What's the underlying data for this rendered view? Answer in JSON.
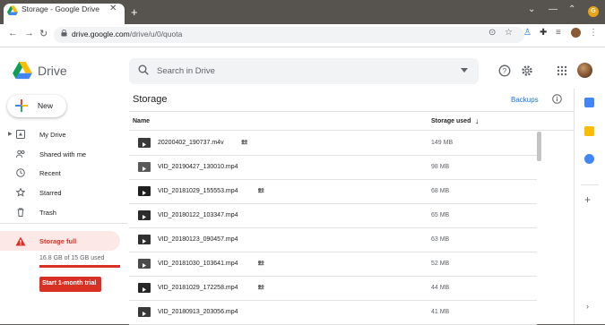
{
  "browser": {
    "tab_title": "Storage - Google Drive",
    "tab_close": "✕",
    "new_tab": "+",
    "window_controls": [
      "⌄",
      "—",
      "⌃",
      "✕"
    ],
    "profile_initial": "G",
    "url_host": "drive.google.com",
    "url_path": "/drive/u/0/quota",
    "nav_icons": [
      "back-icon",
      "forward-icon",
      "reload-icon"
    ],
    "toolbar_icons": [
      "lens-icon",
      "bookmark-star-icon",
      "extension-icon",
      "puzzle-icon",
      "media-icon",
      "profile-icon",
      "menu-icon"
    ]
  },
  "drive": {
    "logo_text": "Drive",
    "search_placeholder": "Search in Drive",
    "new_label": "New",
    "nav": [
      {
        "label": "My Drive",
        "icon": "my-drive-icon"
      },
      {
        "label": "Shared with me",
        "icon": "shared-icon"
      },
      {
        "label": "Recent",
        "icon": "clock-icon"
      },
      {
        "label": "Starred",
        "icon": "star-icon"
      },
      {
        "label": "Trash",
        "icon": "trash-icon"
      }
    ],
    "storage_full_label": "Storage full",
    "usage_text": "16.8 GB of 15 GB used",
    "trial_button": "Start 1-month trial",
    "page_title": "Storage",
    "backups_label": "Backups",
    "col_name": "Name",
    "col_storage": "Storage used",
    "files": [
      {
        "name": "20200402_190737.m4v",
        "size": "149 MB",
        "shared": true
      },
      {
        "name": "VID_20190427_130010.mp4",
        "size": "98 MB",
        "shared": false
      },
      {
        "name": "VID_20181029_155553.mp4",
        "size": "68 MB",
        "shared": true
      },
      {
        "name": "VID_20180122_103347.mp4",
        "size": "65 MB",
        "shared": false
      },
      {
        "name": "VID_20180123_090457.mp4",
        "size": "63 MB",
        "shared": false
      },
      {
        "name": "VID_20181030_103641.mp4",
        "size": "52 MB",
        "shared": true
      },
      {
        "name": "VID_20181029_172258.mp4",
        "size": "44 MB",
        "shared": true
      },
      {
        "name": "VID_20180913_203056.mp4",
        "size": "41 MB",
        "shared": false
      }
    ],
    "colors": {
      "accent": "#1a73e8",
      "danger": "#d93025",
      "warn_bg": "#fce8e6"
    }
  }
}
